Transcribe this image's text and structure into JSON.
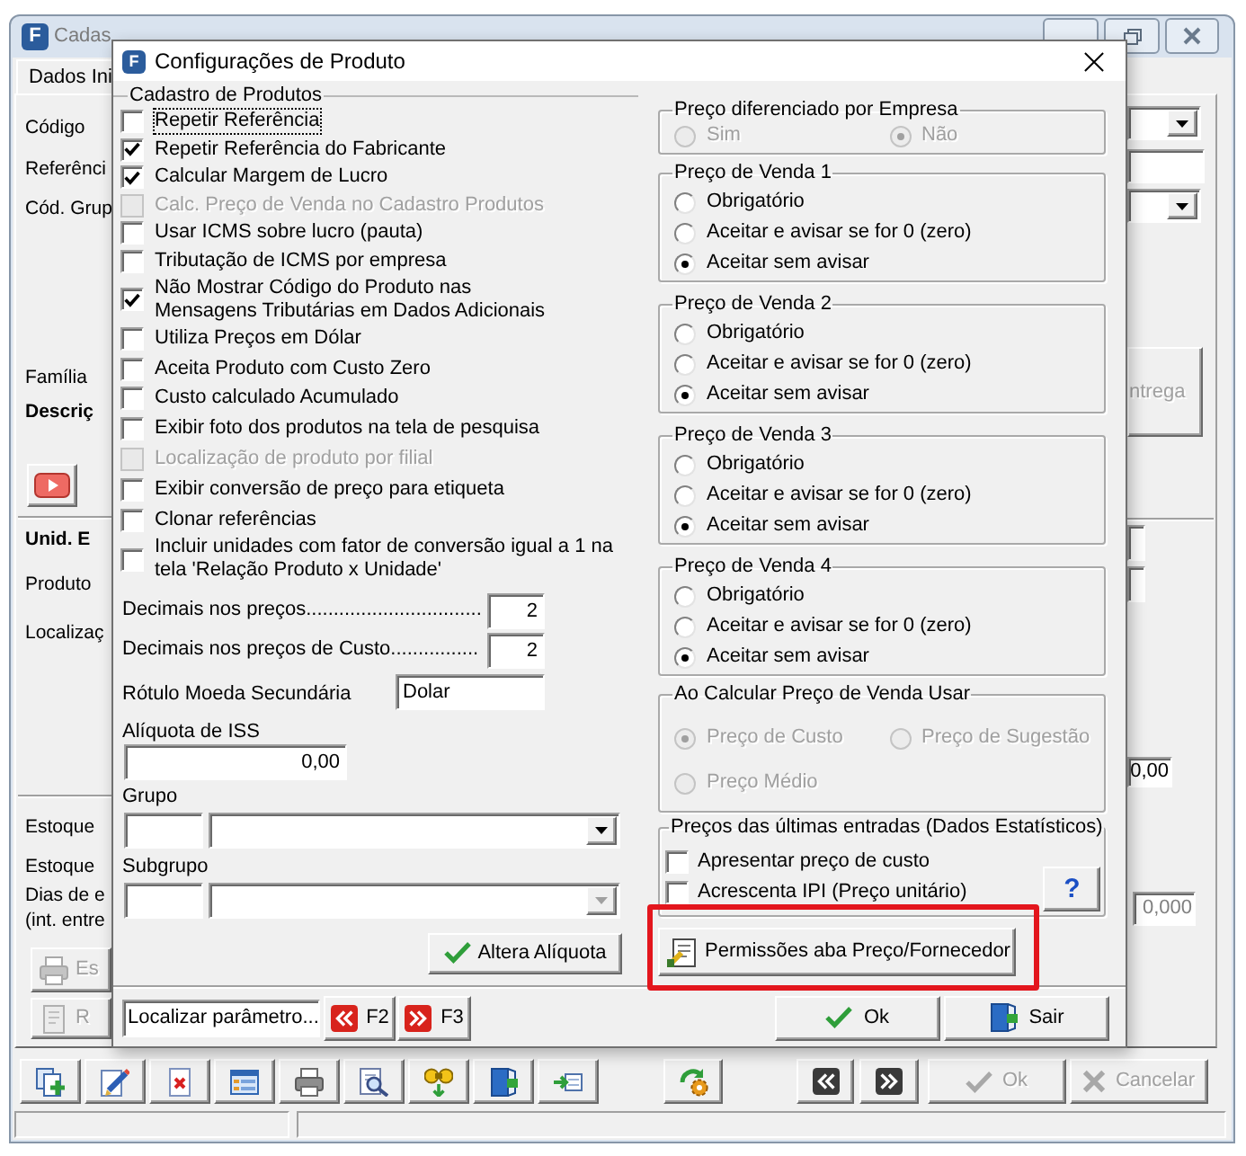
{
  "background_window": {
    "icon": "F",
    "title": "Cadas",
    "tab": {
      "label": "Dados Ini"
    },
    "left_items": [
      {
        "kind": "label",
        "text": "Código"
      },
      {
        "kind": "label",
        "text": "Referênci"
      },
      {
        "kind": "label",
        "text": "Cód. Grup"
      },
      {
        "kind": "label",
        "text": "Família"
      },
      {
        "kind": "heading",
        "text": "Descriç"
      },
      {
        "kind": "play_button"
      },
      {
        "kind": "heading",
        "text": "Unid. E"
      },
      {
        "kind": "label",
        "text": "Produto"
      },
      {
        "kind": "label",
        "text": "Localizaç"
      },
      {
        "kind": "label",
        "text": "Estoque"
      },
      {
        "kind": "label",
        "text": "Estoque"
      },
      {
        "kind": "label",
        "text": "Dias de e"
      },
      {
        "kind": "label",
        "text": "(int. entre"
      },
      {
        "kind": "printer_button",
        "text": "Es",
        "disabled": true
      },
      {
        "kind": "document_button",
        "text": "R",
        "disabled": true
      }
    ],
    "right_items": [
      {
        "kind": "combo"
      },
      {
        "kind": "field"
      },
      {
        "kind": "combo"
      },
      {
        "kind": "button",
        "text": "ntrega",
        "disabled": true
      },
      {
        "kind": "field"
      },
      {
        "kind": "field"
      },
      {
        "kind": "field",
        "value": "0,00"
      },
      {
        "kind": "field",
        "value": "0,000",
        "disabled": true
      }
    ],
    "bottom_buttons": [
      {
        "kind": "ok",
        "label": "Ok",
        "disabled": true
      },
      {
        "kind": "cancel",
        "label": "Cancelar",
        "disabled": true
      }
    ]
  },
  "dialog": {
    "icon": "F",
    "title": "Configurações de Produto",
    "product_settings": {
      "title": "Cadastro de Produtos",
      "options": [
        {
          "label": "Repetir Referência",
          "checked": false,
          "disabled": false,
          "focused": true
        },
        {
          "label": "Repetir Referência do Fabricante",
          "checked": true,
          "disabled": false,
          "focused": false
        },
        {
          "label": "Calcular Margem de Lucro",
          "checked": true,
          "disabled": false,
          "focused": false
        },
        {
          "label": "Calc. Preço de Venda no Cadastro Produtos",
          "checked": false,
          "disabled": true,
          "focused": false
        },
        {
          "label": "Usar ICMS sobre lucro (pauta)",
          "checked": false,
          "disabled": false,
          "focused": false
        },
        {
          "label": "Tributação de ICMS por empresa",
          "checked": false,
          "disabled": false,
          "focused": false
        },
        {
          "label": "Não Mostrar Código do Produto nas\nMensagens Tributárias em Dados Adicionais",
          "checked": true,
          "disabled": false,
          "focused": false
        },
        {
          "label": "Utiliza Preços em Dólar",
          "checked": false,
          "disabled": false,
          "focused": false
        },
        {
          "label": "Aceita Produto com Custo Zero",
          "checked": false,
          "disabled": false,
          "focused": false
        },
        {
          "label": "Custo calculado Acumulado",
          "checked": false,
          "disabled": false,
          "focused": false
        },
        {
          "label": "Exibir foto dos produtos na tela de pesquisa",
          "checked": false,
          "disabled": false,
          "focused": false
        },
        {
          "label": "Localização de produto por filial",
          "checked": false,
          "disabled": true,
          "focused": false
        },
        {
          "label": "Exibir conversão de preço para etiqueta",
          "checked": false,
          "disabled": false,
          "focused": false
        },
        {
          "label": "Clonar referências",
          "checked": false,
          "disabled": false,
          "focused": false
        },
        {
          "label": "Incluir unidades com fator de conversão igual a 1 na\ntela 'Relação Produto x Unidade'",
          "checked": false,
          "disabled": false,
          "focused": false
        }
      ]
    },
    "decimals": [
      {
        "label": "Decimais nos preços................................",
        "value": "2"
      },
      {
        "label": "Decimais nos preços de Custo................",
        "value": "2"
      }
    ],
    "currency_label": {
      "label": "Rótulo Moeda Secundária",
      "value": "Dolar"
    },
    "iss_rate": {
      "label": "Alíquota de ISS",
      "value": "0,00"
    },
    "group": {
      "label": "Grupo",
      "disabled": false
    },
    "subgroup": {
      "label": "Subgrupo",
      "disabled": true
    },
    "change_rate_button": "Altera Alíquota",
    "company_price": {
      "title": "Preço diferenciado por Empresa",
      "disabled": true,
      "options": [
        {
          "label": "Sim",
          "selected": false
        },
        {
          "label": "Não",
          "selected": true
        }
      ]
    },
    "sale_prices": [
      {
        "title": "Preço de Venda 1",
        "options": [
          {
            "label": "Obrigatório",
            "selected": false
          },
          {
            "label": "Aceitar e avisar se for 0 (zero)",
            "selected": false
          },
          {
            "label": "Aceitar sem avisar",
            "selected": true
          }
        ]
      },
      {
        "title": "Preço de Venda 2",
        "options": [
          {
            "label": "Obrigatório",
            "selected": false
          },
          {
            "label": "Aceitar e avisar se for 0 (zero)",
            "selected": false
          },
          {
            "label": "Aceitar sem avisar",
            "selected": true
          }
        ]
      },
      {
        "title": "Preço de Venda 3",
        "options": [
          {
            "label": "Obrigatório",
            "selected": false
          },
          {
            "label": "Aceitar e avisar se for 0 (zero)",
            "selected": false
          },
          {
            "label": "Aceitar sem avisar",
            "selected": true
          }
        ]
      },
      {
        "title": "Preço de Venda 4",
        "options": [
          {
            "label": "Obrigatório",
            "selected": false
          },
          {
            "label": "Aceitar e avisar se for 0 (zero)",
            "selected": false
          },
          {
            "label": "Aceitar sem avisar",
            "selected": true
          }
        ]
      }
    ],
    "price_basis": {
      "title": "Ao Calcular Preço de Venda Usar",
      "disabled": true,
      "options": [
        {
          "label": "Preço de Custo",
          "selected": true
        },
        {
          "label": "Preço de Sugestão",
          "selected": false
        },
        {
          "label": "Preço Médio",
          "selected": false
        }
      ]
    },
    "last_entries": {
      "title": "Preços das últimas entradas (Dados Estatísticos)",
      "options": [
        {
          "label": "Apresentar preço de custo",
          "checked": false
        },
        {
          "label": "Acrescenta IPI (Preço unitário)",
          "checked": false
        }
      ],
      "help": "?"
    },
    "permissions_button": {
      "label": "Permissões aba Preço/Fornecedor",
      "highlighted": true
    },
    "search": {
      "value": "Localizar parâmetro..."
    },
    "nav_buttons": [
      {
        "kind": "previous",
        "label": "F2"
      },
      {
        "kind": "next",
        "label": "F3"
      }
    ],
    "buttons": [
      {
        "kind": "ok",
        "label": "Ok"
      },
      {
        "kind": "exit",
        "label": "Sair"
      }
    ]
  }
}
